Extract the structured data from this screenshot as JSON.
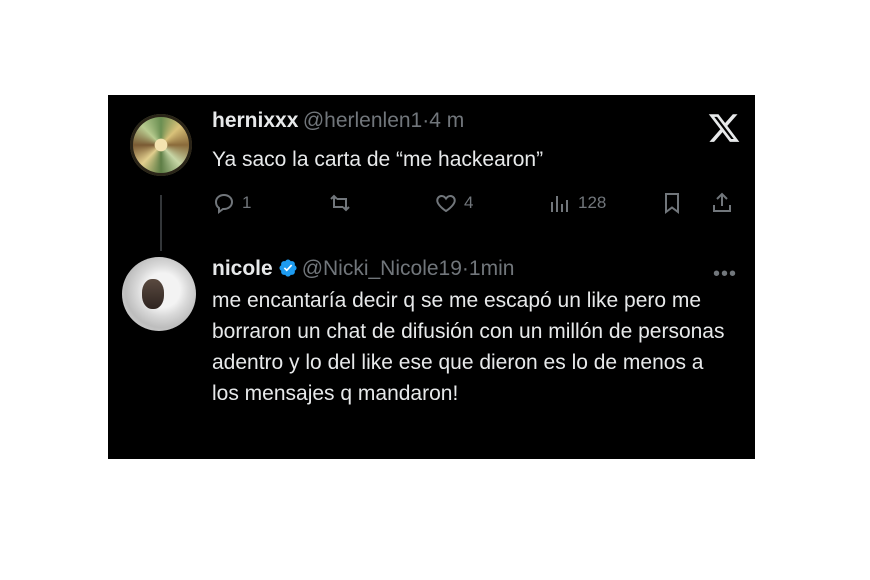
{
  "tweet_original": {
    "display_name": "hernixxx",
    "handle": "@herlenlen1",
    "separator": "·",
    "time": "4 m",
    "text": "Ya saco la carta de “me hackearon”",
    "replies": "1",
    "retweets": "",
    "likes": "4",
    "views": "128"
  },
  "tweet_reply": {
    "display_name": "nicole",
    "handle": "@Nicki_Nicole19",
    "separator": "·",
    "time": "1min",
    "text": "me encantaría decir q se me escapó un like pero me borraron un chat de difusión con un millón de personas adentro y lo del like ese que dieron es lo de menos a los mensajes q mandaron!",
    "more": "•••"
  },
  "colors": {
    "background": "#000000",
    "text": "#e7e9ea",
    "muted": "#71767b",
    "verified": "#1d9bf0"
  },
  "icons": [
    "x-logo-icon",
    "reply-icon",
    "retweet-icon",
    "like-icon",
    "views-icon",
    "bookmark-icon",
    "share-icon",
    "verified-badge-icon",
    "more-icon"
  ]
}
